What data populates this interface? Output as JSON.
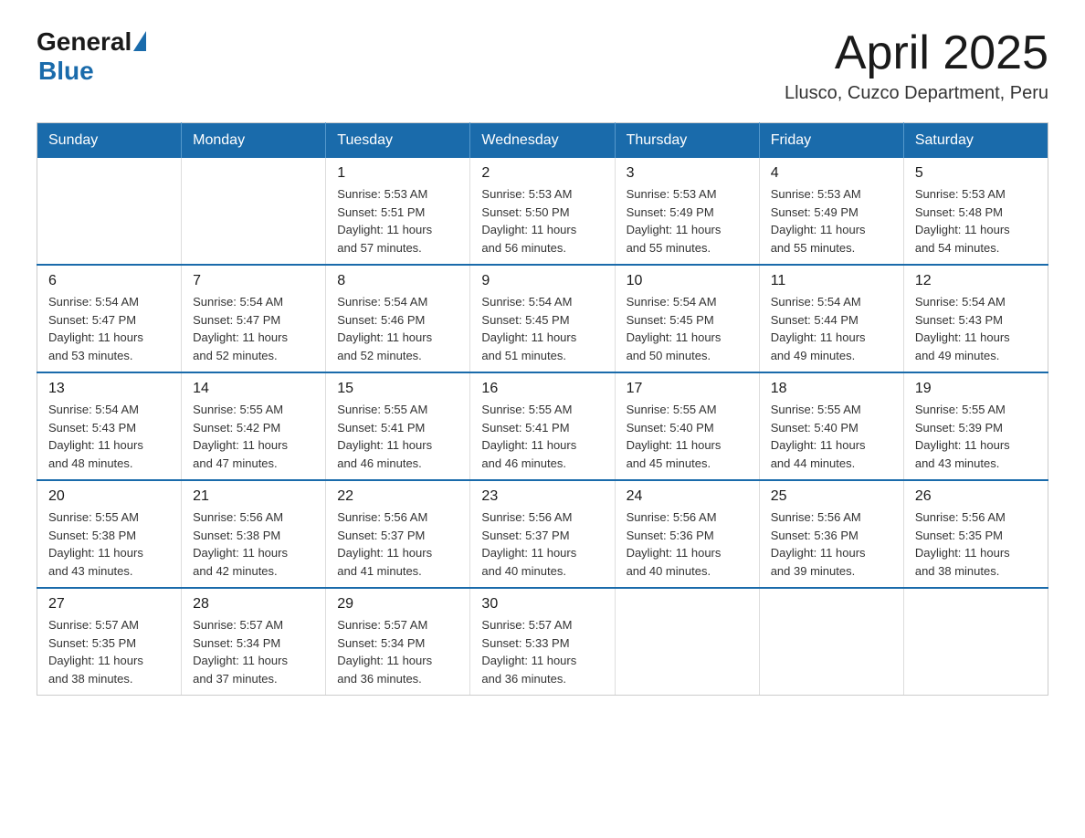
{
  "header": {
    "logo": {
      "general": "General",
      "blue": "Blue"
    },
    "title": "April 2025",
    "location": "Llusco, Cuzco Department, Peru"
  },
  "calendar": {
    "days_of_week": [
      "Sunday",
      "Monday",
      "Tuesday",
      "Wednesday",
      "Thursday",
      "Friday",
      "Saturday"
    ],
    "weeks": [
      [
        {
          "day": "",
          "info": ""
        },
        {
          "day": "",
          "info": ""
        },
        {
          "day": "1",
          "info": "Sunrise: 5:53 AM\nSunset: 5:51 PM\nDaylight: 11 hours\nand 57 minutes."
        },
        {
          "day": "2",
          "info": "Sunrise: 5:53 AM\nSunset: 5:50 PM\nDaylight: 11 hours\nand 56 minutes."
        },
        {
          "day": "3",
          "info": "Sunrise: 5:53 AM\nSunset: 5:49 PM\nDaylight: 11 hours\nand 55 minutes."
        },
        {
          "day": "4",
          "info": "Sunrise: 5:53 AM\nSunset: 5:49 PM\nDaylight: 11 hours\nand 55 minutes."
        },
        {
          "day": "5",
          "info": "Sunrise: 5:53 AM\nSunset: 5:48 PM\nDaylight: 11 hours\nand 54 minutes."
        }
      ],
      [
        {
          "day": "6",
          "info": "Sunrise: 5:54 AM\nSunset: 5:47 PM\nDaylight: 11 hours\nand 53 minutes."
        },
        {
          "day": "7",
          "info": "Sunrise: 5:54 AM\nSunset: 5:47 PM\nDaylight: 11 hours\nand 52 minutes."
        },
        {
          "day": "8",
          "info": "Sunrise: 5:54 AM\nSunset: 5:46 PM\nDaylight: 11 hours\nand 52 minutes."
        },
        {
          "day": "9",
          "info": "Sunrise: 5:54 AM\nSunset: 5:45 PM\nDaylight: 11 hours\nand 51 minutes."
        },
        {
          "day": "10",
          "info": "Sunrise: 5:54 AM\nSunset: 5:45 PM\nDaylight: 11 hours\nand 50 minutes."
        },
        {
          "day": "11",
          "info": "Sunrise: 5:54 AM\nSunset: 5:44 PM\nDaylight: 11 hours\nand 49 minutes."
        },
        {
          "day": "12",
          "info": "Sunrise: 5:54 AM\nSunset: 5:43 PM\nDaylight: 11 hours\nand 49 minutes."
        }
      ],
      [
        {
          "day": "13",
          "info": "Sunrise: 5:54 AM\nSunset: 5:43 PM\nDaylight: 11 hours\nand 48 minutes."
        },
        {
          "day": "14",
          "info": "Sunrise: 5:55 AM\nSunset: 5:42 PM\nDaylight: 11 hours\nand 47 minutes."
        },
        {
          "day": "15",
          "info": "Sunrise: 5:55 AM\nSunset: 5:41 PM\nDaylight: 11 hours\nand 46 minutes."
        },
        {
          "day": "16",
          "info": "Sunrise: 5:55 AM\nSunset: 5:41 PM\nDaylight: 11 hours\nand 46 minutes."
        },
        {
          "day": "17",
          "info": "Sunrise: 5:55 AM\nSunset: 5:40 PM\nDaylight: 11 hours\nand 45 minutes."
        },
        {
          "day": "18",
          "info": "Sunrise: 5:55 AM\nSunset: 5:40 PM\nDaylight: 11 hours\nand 44 minutes."
        },
        {
          "day": "19",
          "info": "Sunrise: 5:55 AM\nSunset: 5:39 PM\nDaylight: 11 hours\nand 43 minutes."
        }
      ],
      [
        {
          "day": "20",
          "info": "Sunrise: 5:55 AM\nSunset: 5:38 PM\nDaylight: 11 hours\nand 43 minutes."
        },
        {
          "day": "21",
          "info": "Sunrise: 5:56 AM\nSunset: 5:38 PM\nDaylight: 11 hours\nand 42 minutes."
        },
        {
          "day": "22",
          "info": "Sunrise: 5:56 AM\nSunset: 5:37 PM\nDaylight: 11 hours\nand 41 minutes."
        },
        {
          "day": "23",
          "info": "Sunrise: 5:56 AM\nSunset: 5:37 PM\nDaylight: 11 hours\nand 40 minutes."
        },
        {
          "day": "24",
          "info": "Sunrise: 5:56 AM\nSunset: 5:36 PM\nDaylight: 11 hours\nand 40 minutes."
        },
        {
          "day": "25",
          "info": "Sunrise: 5:56 AM\nSunset: 5:36 PM\nDaylight: 11 hours\nand 39 minutes."
        },
        {
          "day": "26",
          "info": "Sunrise: 5:56 AM\nSunset: 5:35 PM\nDaylight: 11 hours\nand 38 minutes."
        }
      ],
      [
        {
          "day": "27",
          "info": "Sunrise: 5:57 AM\nSunset: 5:35 PM\nDaylight: 11 hours\nand 38 minutes."
        },
        {
          "day": "28",
          "info": "Sunrise: 5:57 AM\nSunset: 5:34 PM\nDaylight: 11 hours\nand 37 minutes."
        },
        {
          "day": "29",
          "info": "Sunrise: 5:57 AM\nSunset: 5:34 PM\nDaylight: 11 hours\nand 36 minutes."
        },
        {
          "day": "30",
          "info": "Sunrise: 5:57 AM\nSunset: 5:33 PM\nDaylight: 11 hours\nand 36 minutes."
        },
        {
          "day": "",
          "info": ""
        },
        {
          "day": "",
          "info": ""
        },
        {
          "day": "",
          "info": ""
        }
      ]
    ]
  }
}
